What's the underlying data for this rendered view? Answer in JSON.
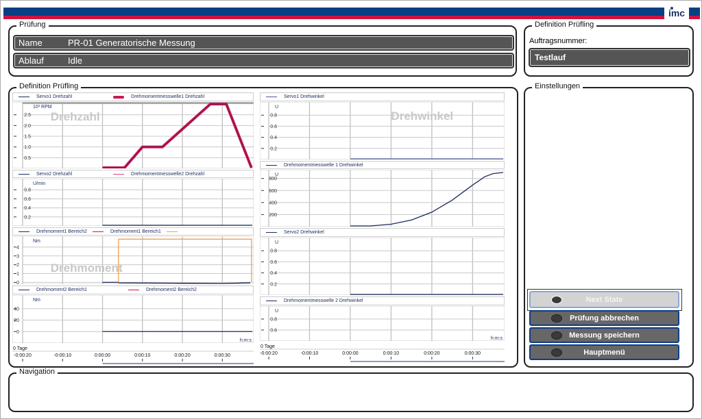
{
  "header": {
    "logo": "imc",
    "colors": {
      "blue": "#0a3f84",
      "red": "#d0123f"
    }
  },
  "pruefung": {
    "title": "Prüfung",
    "name_label": "Name",
    "name_value": "PR-01 Generatorische Messung",
    "ablauf_label": "Ablauf",
    "ablauf_value": "Idle"
  },
  "definition_right": {
    "title": "Definition Prüfling",
    "auftrag_label": "Auftragsnummer:",
    "auftrag_value": "Testlauf"
  },
  "charts_group": {
    "title": "Definition Prüfling"
  },
  "einstellungen": {
    "title": "Einstellungen",
    "buttons": [
      {
        "label": "Next State",
        "state": "disabled"
      },
      {
        "label": "Prüfung abbrechen"
      },
      {
        "label": "Messung speichern"
      },
      {
        "label": "Hauptmenü"
      }
    ]
  },
  "navigation": {
    "title": "Navigation"
  },
  "chart_data": {
    "type": "line",
    "xaxis": {
      "unit": "h:m:s",
      "day_label": "0 Tage",
      "xlim": [
        -20,
        37.5
      ],
      "ticks": [
        -20,
        -10,
        0,
        10,
        20,
        30
      ],
      "tick_labels": [
        "-0:00:20",
        "-0:00:10",
        "0:00:00",
        "0:00:10",
        "0:00:20",
        "0:00:30"
      ]
    },
    "columns": [
      {
        "watermarks": [
          "Drehzahl",
          "",
          "Drehmoment",
          ""
        ],
        "panels": [
          {
            "unit": "10³ RPM",
            "watermark": "Drehzahl",
            "ylim": [
              0,
              3
            ],
            "yticks": [
              0.5,
              1.0,
              1.5,
              2.0,
              2.5
            ],
            "ytick_labels": [
              "0.5",
              "1.0",
              "1.5",
              "2.0",
              "2.5"
            ],
            "series": [
              {
                "name": "Servo1 Drehzahl",
                "color": "#1b2a5c",
                "points": [
                  [
                    0,
                    0
                  ],
                  [
                    5.5,
                    0
                  ],
                  [
                    10,
                    1
                  ],
                  [
                    15,
                    1
                  ],
                  [
                    27,
                    3
                  ],
                  [
                    31,
                    3
                  ],
                  [
                    37.3,
                    0
                  ]
                ]
              },
              {
                "name": "Drehmomentmesswelle1 Drehzahl",
                "color": "#c8185a",
                "thick": true,
                "points": [
                  [
                    0,
                    0
                  ],
                  [
                    5.5,
                    0
                  ],
                  [
                    10,
                    1
                  ],
                  [
                    15,
                    1
                  ],
                  [
                    27,
                    3
                  ],
                  [
                    31,
                    3
                  ],
                  [
                    37.3,
                    0
                  ]
                ]
              }
            ]
          },
          {
            "unit": "U/min",
            "ylim": [
              0,
              1
            ],
            "yticks": [
              0.2,
              0.4,
              0.6,
              0.8
            ],
            "ytick_labels": [
              "0.2",
              "0.4",
              "0.6",
              "0.8"
            ],
            "series": [
              {
                "name": "Servo2 Drehzahl",
                "color": "#1b2a5c",
                "points": [
                  [
                    0,
                    0
                  ],
                  [
                    37.5,
                    0
                  ]
                ]
              },
              {
                "name": "Drehmomentmesswelle2 Drehzahl",
                "color": "#e0447a",
                "points": []
              }
            ]
          },
          {
            "unit": "Nm",
            "watermark": "Drehmoment",
            "ylim": [
              -0.2,
              5
            ],
            "yticks": [
              0,
              1,
              2,
              3,
              4
            ],
            "ytick_labels": [
              "0",
              "1",
              "2",
              "3",
              "4"
            ],
            "series": [
              {
                "name": "Drehmoment1 Bereich2",
                "color": "#1b2a5c",
                "points": [
                  [
                    0,
                    0
                  ],
                  [
                    4,
                    0
                  ],
                  [
                    4.1,
                    -0.05
                  ],
                  [
                    20,
                    -0.1
                  ],
                  [
                    30,
                    -0.15
                  ],
                  [
                    37,
                    -0.05
                  ]
                ]
              },
              {
                "name": "Drehmoment1 Bereich1",
                "color": "#c8185a",
                "points": []
              },
              {
                "name": "",
                "color": "#f0a050",
                "points": [
                  [
                    4,
                    0
                  ],
                  [
                    4,
                    4.9
                  ],
                  [
                    37.3,
                    4.9
                  ],
                  [
                    37.3,
                    0
                  ]
                ]
              }
            ]
          },
          {
            "unit": "Nm",
            "ylim": [
              -20,
              60
            ],
            "yticks": [
              0,
              20,
              40
            ],
            "ytick_labels": [
              "0",
              "20",
              "40"
            ],
            "series": [
              {
                "name": "Drehmoment2 Bereich1",
                "color": "#1b2a5c",
                "points": [
                  [
                    0,
                    0
                  ],
                  [
                    37.5,
                    0
                  ]
                ]
              },
              {
                "name": "Drehmoment2 Bereich2",
                "color": "#c8185a",
                "points": []
              }
            ]
          }
        ]
      },
      {
        "panels": [
          {
            "unit": "U",
            "watermark": "Drehwinkel",
            "ylim": [
              0,
              1
            ],
            "yticks": [
              0.2,
              0.4,
              0.6,
              0.8
            ],
            "ytick_labels": [
              "0.2",
              "0.4",
              "0.6",
              "0.8"
            ],
            "series": [
              {
                "name": "Servo1 Drehwinkel",
                "color": "#4a5a9c",
                "points": [
                  [
                    0,
                    0
                  ],
                  [
                    37.5,
                    0
                  ]
                ]
              }
            ]
          },
          {
            "unit": "U",
            "ylim": [
              0,
              910
            ],
            "yticks": [
              200,
              400,
              600,
              800
            ],
            "ytick_labels": [
              "200",
              "400",
              "600",
              "800"
            ],
            "series": [
              {
                "name": "Drehmomentmesswelle 1 Drehwinkel",
                "color": "#1b2a5c",
                "points": [
                  [
                    0,
                    0
                  ],
                  [
                    5,
                    0
                  ],
                  [
                    10,
                    40
                  ],
                  [
                    15,
                    110
                  ],
                  [
                    20,
                    240
                  ],
                  [
                    25,
                    440
                  ],
                  [
                    30,
                    690
                  ],
                  [
                    33,
                    830
                  ],
                  [
                    35,
                    880
                  ],
                  [
                    37.5,
                    900
                  ]
                ]
              }
            ]
          },
          {
            "unit": "U",
            "ylim": [
              0,
              1
            ],
            "yticks": [
              0.2,
              0.4,
              0.6,
              0.8
            ],
            "ytick_labels": [
              "0.2",
              "0.4",
              "0.6",
              "0.8"
            ],
            "series": [
              {
                "name": "Servo2 Drehwinkel",
                "color": "#1b2a5c",
                "points": [
                  [
                    0,
                    0
                  ],
                  [
                    37.5,
                    0
                  ]
                ]
              }
            ]
          },
          {
            "unit": "U",
            "ylim": [
              0.4,
              1
            ],
            "yticks": [
              0.6,
              0.8
            ],
            "ytick_labels": [
              "0.6",
              "0.8"
            ],
            "series": [
              {
                "name": "Drehmomentmesswelle 2 Drehwinkel",
                "color": "#1b2a5c",
                "points": []
              }
            ]
          }
        ]
      }
    ]
  }
}
